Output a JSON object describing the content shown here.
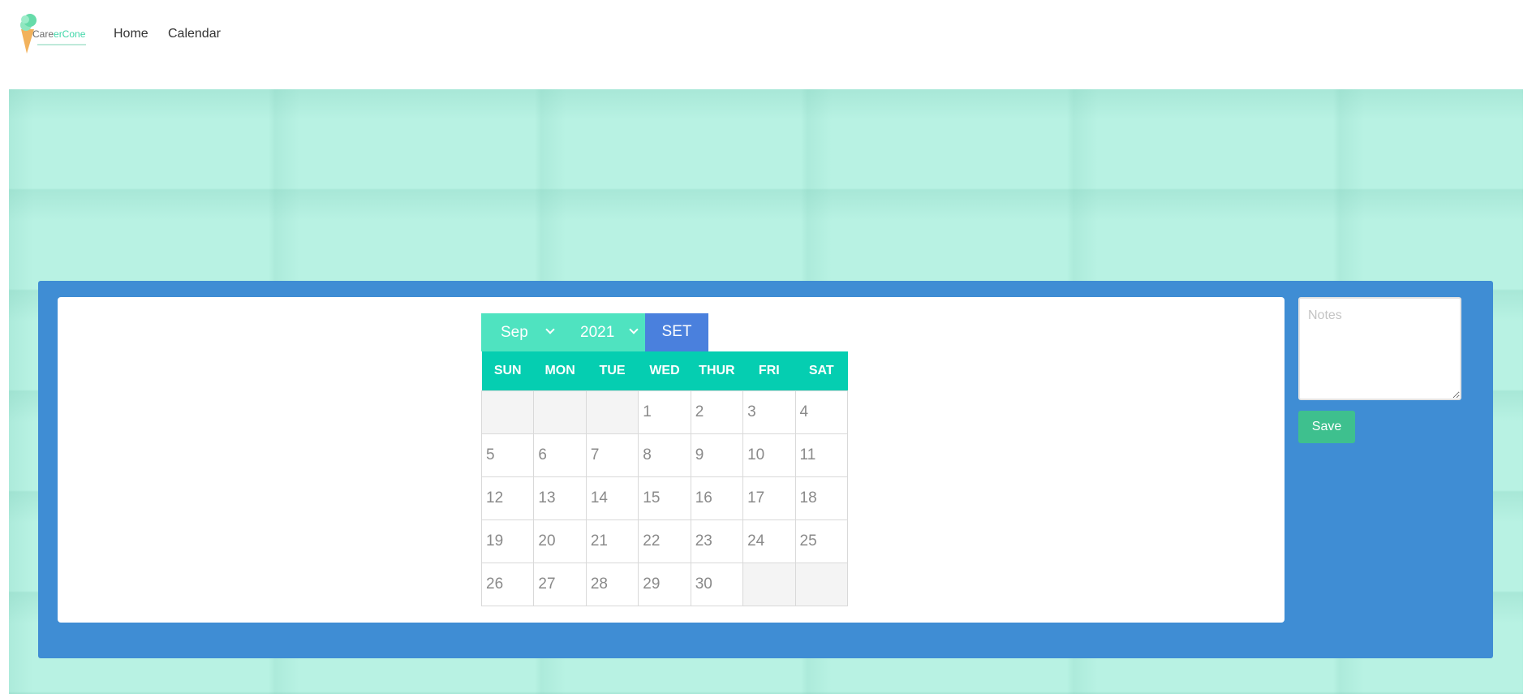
{
  "brand": {
    "name_part1": "Care",
    "name_part2": "erCone"
  },
  "nav": {
    "home_label": "Home",
    "calendar_label": "Calendar"
  },
  "calendar": {
    "month_selected": "Sep",
    "year_selected": "2021",
    "set_label": "SET",
    "weekdays": [
      "SUN",
      "MON",
      "TUE",
      "WED",
      "THUR",
      "FRI",
      "SAT"
    ],
    "weeks": [
      [
        "",
        "",
        "",
        "1",
        "2",
        "3",
        "4"
      ],
      [
        "5",
        "6",
        "7",
        "8",
        "9",
        "10",
        "11"
      ],
      [
        "12",
        "13",
        "14",
        "15",
        "16",
        "17",
        "18"
      ],
      [
        "19",
        "20",
        "21",
        "22",
        "23",
        "24",
        "25"
      ],
      [
        "26",
        "27",
        "28",
        "29",
        "30",
        "",
        ""
      ]
    ]
  },
  "notes": {
    "placeholder": "Notes",
    "save_label": "Save"
  },
  "colors": {
    "panel": "#3f8dd4",
    "header_row": "#05ceb1",
    "select_bg": "#4fe3c0",
    "set_button": "#4a80dd",
    "save_button": "#3ec08e",
    "hero_bg": "#b8f2e3"
  }
}
